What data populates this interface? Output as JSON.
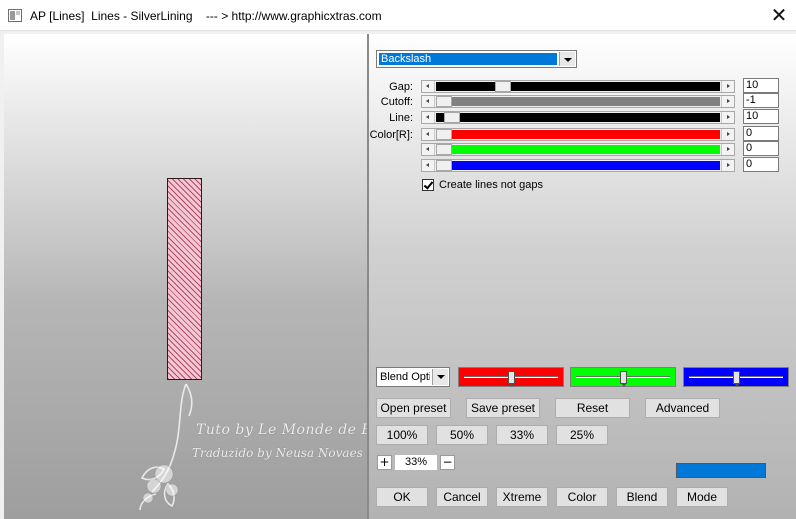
{
  "window": {
    "title": "AP [Lines]  Lines - SilverLining    --- > http://www.graphicxtras.com",
    "close_glyph": "✕"
  },
  "preview": {
    "watermark_line1": "Tuto by Le Monde de Bea",
    "watermark_line2": "Traduzido by Neusa Novaes"
  },
  "colors": {
    "accent": "#0078d7",
    "red": "#ff0000",
    "green": "#00ff00",
    "blue": "#0000ff",
    "swatch": "#0078d7"
  },
  "icons": {
    "app": "window-app-icon",
    "close": "close-icon",
    "dropdown": "chevron-down-icon",
    "check": "checkmark-icon"
  },
  "controls": {
    "pattern": {
      "selected": "Backslash"
    },
    "params": [
      {
        "label": "Gap:",
        "value": "10",
        "fraction": 0.22,
        "fill": "#000000"
      },
      {
        "label": "Cutoff:",
        "value": "-1",
        "fraction": 0.0,
        "fill": "#808080"
      },
      {
        "label": "Line:",
        "value": "10",
        "fraction": 0.03,
        "fill": "#000000"
      },
      {
        "label": "Color[R]:",
        "value": "0",
        "fraction": 0.0,
        "fill": "#ff0000"
      },
      {
        "label": "",
        "value": "0",
        "fraction": 0.0,
        "fill": "#00ff00"
      },
      {
        "label": "",
        "value": "0",
        "fraction": 0.0,
        "fill": "#0000ff"
      }
    ],
    "create_lines": {
      "checked": true,
      "label": "Create lines not gaps"
    },
    "blend": {
      "selected": "Blend Optio",
      "channels": [
        {
          "name": "red",
          "fraction": 0.5
        },
        {
          "name": "green",
          "fraction": 0.5
        },
        {
          "name": "blue",
          "fraction": 0.5
        }
      ]
    }
  },
  "buttons": {
    "open_preset": "Open preset",
    "save_preset": "Save preset",
    "reset": "Reset",
    "advanced": "Advanced",
    "zoom100": "100%",
    "zoom50": "50%",
    "zoom33": "33%",
    "zoom25": "25%",
    "ok": "OK",
    "cancel": "Cancel",
    "xtreme": "Xtreme",
    "color": "Color",
    "blend": "Blend",
    "mode": "Mode"
  },
  "zoom": {
    "plus": "+",
    "value": "33%",
    "minus": "−"
  }
}
